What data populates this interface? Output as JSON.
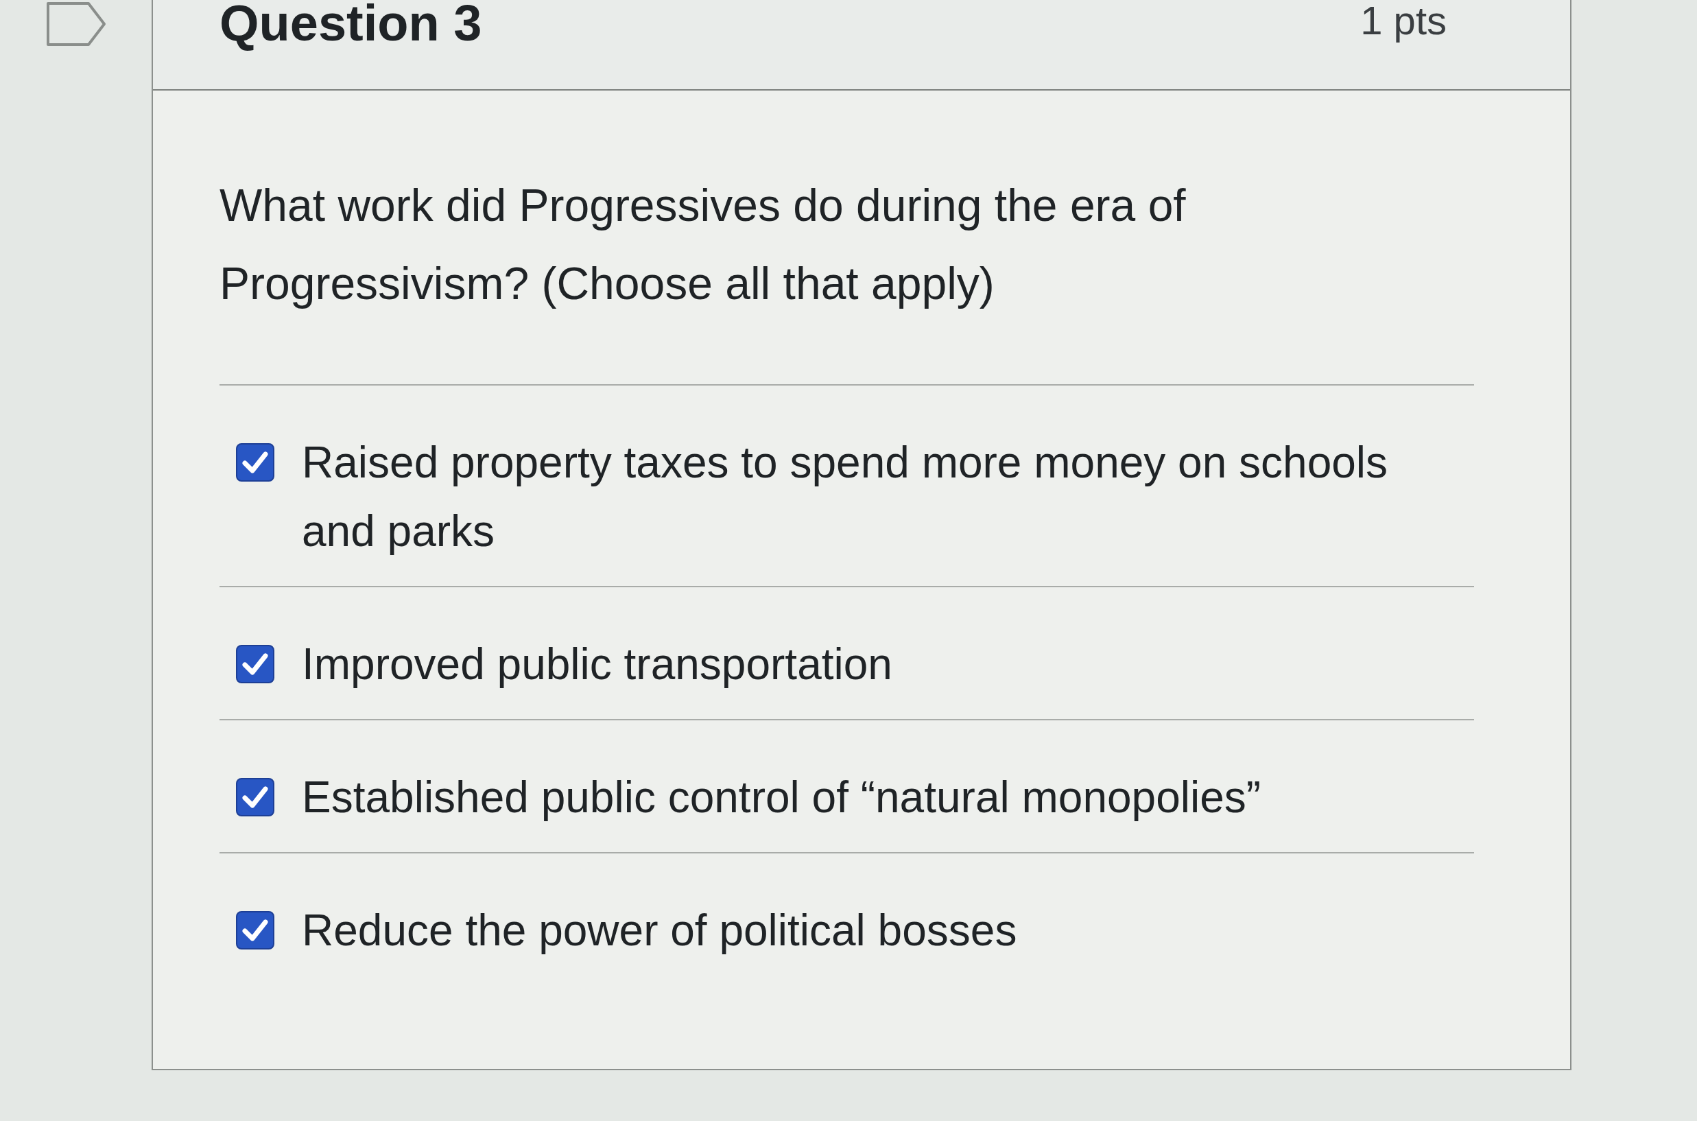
{
  "header": {
    "title": "Question 3",
    "points": "1 pts"
  },
  "question": {
    "text": "What work did Progressives do during the era of Progressivism? (Choose all that apply)"
  },
  "answers": [
    {
      "label": "Raised property taxes to spend more money on schools and parks",
      "checked": true
    },
    {
      "label": "Improved public transportation",
      "checked": true
    },
    {
      "label": "Established public control of “natural monopolies”",
      "checked": true
    },
    {
      "label": "Reduce the power of political bosses",
      "checked": true
    }
  ]
}
